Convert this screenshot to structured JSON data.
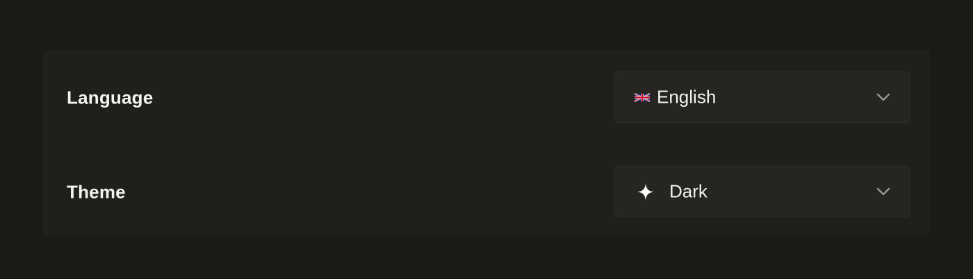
{
  "settings": {
    "language": {
      "label": "Language",
      "selected": "English",
      "icon": "uk-flag-icon"
    },
    "theme": {
      "label": "Theme",
      "selected": "Dark",
      "icon": "sparkle-icon"
    }
  },
  "colors": {
    "background": "#1b1a17",
    "panel": "#201f1c",
    "select_bg": "#262522",
    "text": "#f3f2ee",
    "chevron": "#9a9893"
  }
}
